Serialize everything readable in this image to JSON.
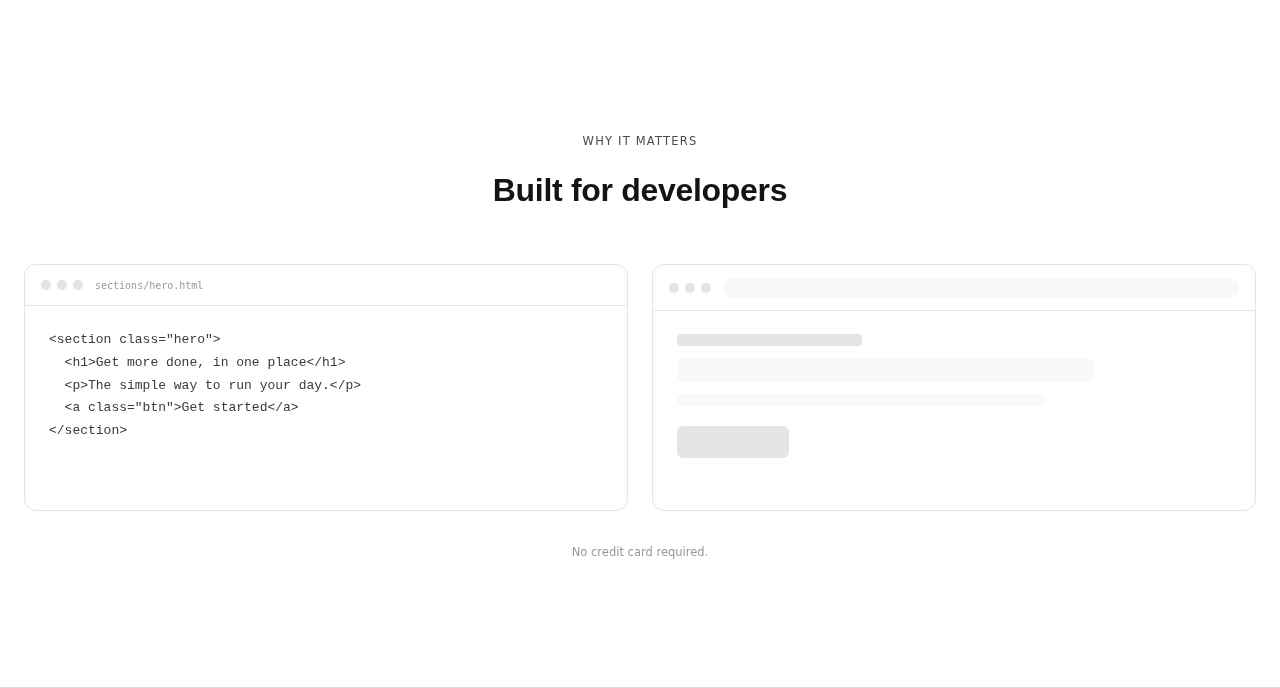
{
  "section": {
    "eyebrow": "WHY IT MATTERS",
    "heading": "Built for developers"
  },
  "code_window": {
    "filename": "sections/hero.html",
    "code_lines": [
      "<section class=\"hero\">",
      "  <h1>Get more done, in one place</h1>",
      "  <p>The simple way to run your day.</p>",
      "  <a class=\"btn\">Get started</a>",
      "</section>"
    ]
  },
  "note": "No credit card required."
}
